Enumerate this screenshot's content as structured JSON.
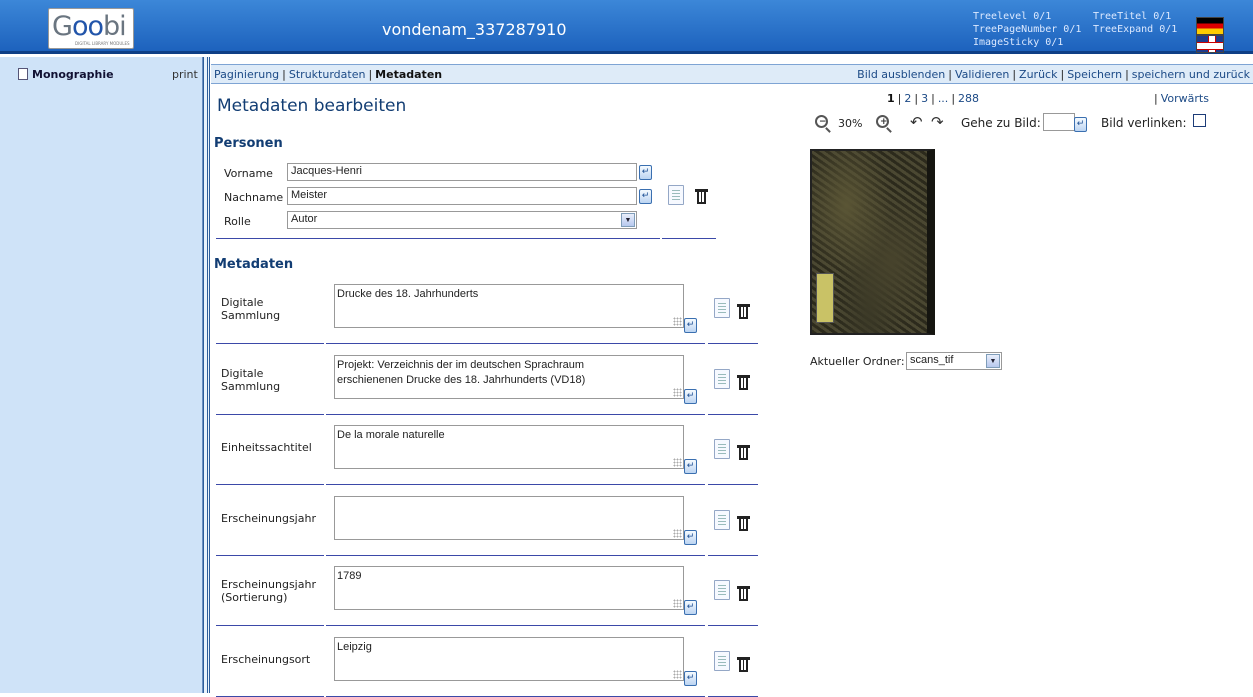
{
  "header": {
    "logo_text": "Goobi",
    "logo_subtext": "DIGITAL LIBRARY MODULES",
    "title": "vondenam_337287910",
    "tree_info": {
      "treelevel": "Treelevel 0/1",
      "treepagenumber": "TreePageNumber 0/1",
      "imagesticky": "ImageSticky 0/1",
      "treetitel": "TreeTitel 0/1",
      "treeexpand": "TreeExpand 0/1"
    },
    "languages": [
      "de",
      "en"
    ]
  },
  "sidebar": {
    "tree_item": "Monographie",
    "print_label": "print"
  },
  "nav": {
    "left": [
      "Paginierung",
      "Strukturdaten",
      "Metadaten"
    ],
    "active": "Metadaten",
    "right": [
      "Bild ausblenden",
      "Validieren",
      "Zurück",
      "Speichern",
      "speichern und zurück"
    ]
  },
  "page": {
    "title": "Metadaten bearbeiten",
    "persons_heading": "Personen",
    "metadata_heading": "Metadaten"
  },
  "person": {
    "vorname_label": "Vorname",
    "vorname_value": "Jacques-Henri",
    "nachname_label": "Nachname",
    "nachname_value": "Meister",
    "rolle_label": "Rolle",
    "rolle_value": "Autor"
  },
  "metadata": [
    {
      "label": "Digitale\nSammlung",
      "value": "Drucke des 18. Jahrhunderts"
    },
    {
      "label": "Digitale\nSammlung",
      "value": "Projekt: Verzeichnis der im deutschen Sprachraum\nerschienenen Drucke des 18. Jahrhunderts (VD18)"
    },
    {
      "label": "Einheitssachtitel",
      "value": "De la morale naturelle"
    },
    {
      "label": "Erscheinungsjahr",
      "value": ""
    },
    {
      "label": "Erscheinungsjahr\n(Sortierung)",
      "value": "1789"
    },
    {
      "label": "Erscheinungsort",
      "value": "Leipzig"
    }
  ],
  "viewer": {
    "pages": [
      "1",
      "2",
      "3",
      "...",
      "288"
    ],
    "current_page": "1",
    "forward_label": "Vorwärts",
    "zoom": "30%",
    "goto_label": "Gehe zu Bild:",
    "goto_value": "",
    "link_label": "Bild verlinken:",
    "link_checked": false,
    "folder_label": "Aktueller Ordner:",
    "folder_value": "scans_tif"
  },
  "icons": {
    "enter": "enter-icon",
    "copy": "copy-icon",
    "delete": "trash-icon",
    "zoom_out": "zoom-out-icon",
    "zoom_in": "zoom-in-icon",
    "rotate_left": "rotate-left-icon",
    "rotate_right": "rotate-right-icon",
    "document": "document-icon"
  },
  "colors": {
    "header_top": "#3c87d8",
    "header_bottom": "#1d62bd",
    "sidebar_bg": "#cfe3f8",
    "heading": "#123d73",
    "link": "#1c4a86",
    "rule": "#3b49a8"
  }
}
